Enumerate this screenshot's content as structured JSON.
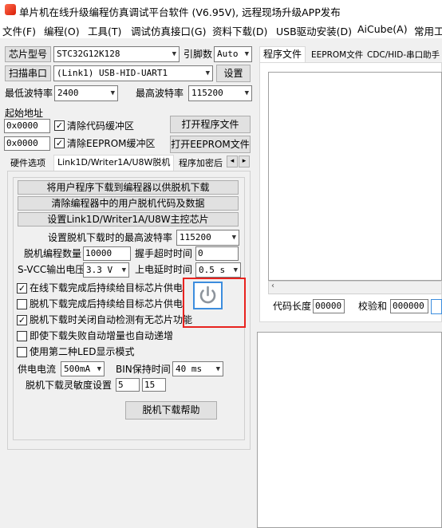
{
  "window": {
    "title": "单片机在线升级编程仿真调试平台软件 (V6.95V), 远程现场升级APP发布"
  },
  "menu": [
    "文件(F)",
    "编程(O)",
    "工具(T)",
    "调试仿真接口(G)",
    "资料下载(D)",
    "USB驱动安装(D)",
    "AiCube(A)",
    "常用工"
  ],
  "left": {
    "chip_label": "芯片型号",
    "chip_value": "STC32G12K128",
    "pin_label": "引脚数",
    "pin_value": "Auto",
    "scan_button": "扫描串口",
    "port_value": "(Link1) USB-HID-UART1",
    "settings_button": "设置",
    "min_baud_label": "最低波特率",
    "min_baud_value": "2400",
    "max_baud_label": "最高波特率",
    "max_baud_value": "115200",
    "start_addr_label": "起始地址",
    "addr1": "0x0000",
    "clear_code_label": "清除代码缓冲区",
    "open_prog_button": "打开程序文件",
    "addr2": "0x0000",
    "clear_eeprom_label": "清除EEPROM缓冲区",
    "open_eeprom_button": "打开EEPROM文件"
  },
  "left_tabs": [
    "硬件选项",
    "Link1D/Writer1A/U8W脱机",
    "程序加密后"
  ],
  "left_tab_arrows": {
    "prev": "◂",
    "next": "▸"
  },
  "offline": {
    "btn_download": "将用户程序下载到编程器以供脱机下载",
    "btn_clear": "清除编程器中的用户脱机代码及数据",
    "btn_master": "设置Link1D/Writer1A/U8W主控芯片",
    "max_baud_label": "设置脱机下载时的最高波特率",
    "max_baud_value": "115200",
    "count_label": "脱机编程数量",
    "count_value": "10000",
    "handshake_label": "握手超时时间",
    "handshake_value": "0",
    "svcc_label": "S-VCC输出电压",
    "svcc_value": "3.3 V",
    "power_delay_label": "上电延时时间",
    "power_delay_value": "0.5 s",
    "checks": [
      {
        "label": "在线下载完成后持续给目标芯片供电",
        "checked": "✓"
      },
      {
        "label": "脱机下载完成后持续给目标芯片供电",
        "checked": ""
      },
      {
        "label": "脱机下载时关闭自动检测有无芯片功能",
        "checked": "✓"
      },
      {
        "label": "即使下载失败自动增量也自动递增",
        "checked": ""
      },
      {
        "label": "使用第二种LED显示模式",
        "checked": ""
      }
    ],
    "supply_label": "供电电流",
    "supply_value": "500mA",
    "bin_label": "BIN保持时间",
    "bin_value": "40 ms",
    "sens_label": "脱机下载灵敏度设置",
    "sens_a": "5",
    "sens_b": "15",
    "help_button": "脱机下载帮助"
  },
  "right_tabs": [
    "程序文件",
    "EEPROM文件",
    "CDC/HID-串口助手"
  ],
  "right": {
    "code_len_label": "代码长度",
    "code_len_value": "00000",
    "checksum_label": "校验和",
    "checksum_value": "000000"
  },
  "colors": {
    "highlight_border": "#e8231f",
    "power_icon": "#8d949c",
    "power_bg": "#ffffff"
  },
  "icons": {
    "power": "power-icon",
    "app": "app-logo-icon"
  }
}
